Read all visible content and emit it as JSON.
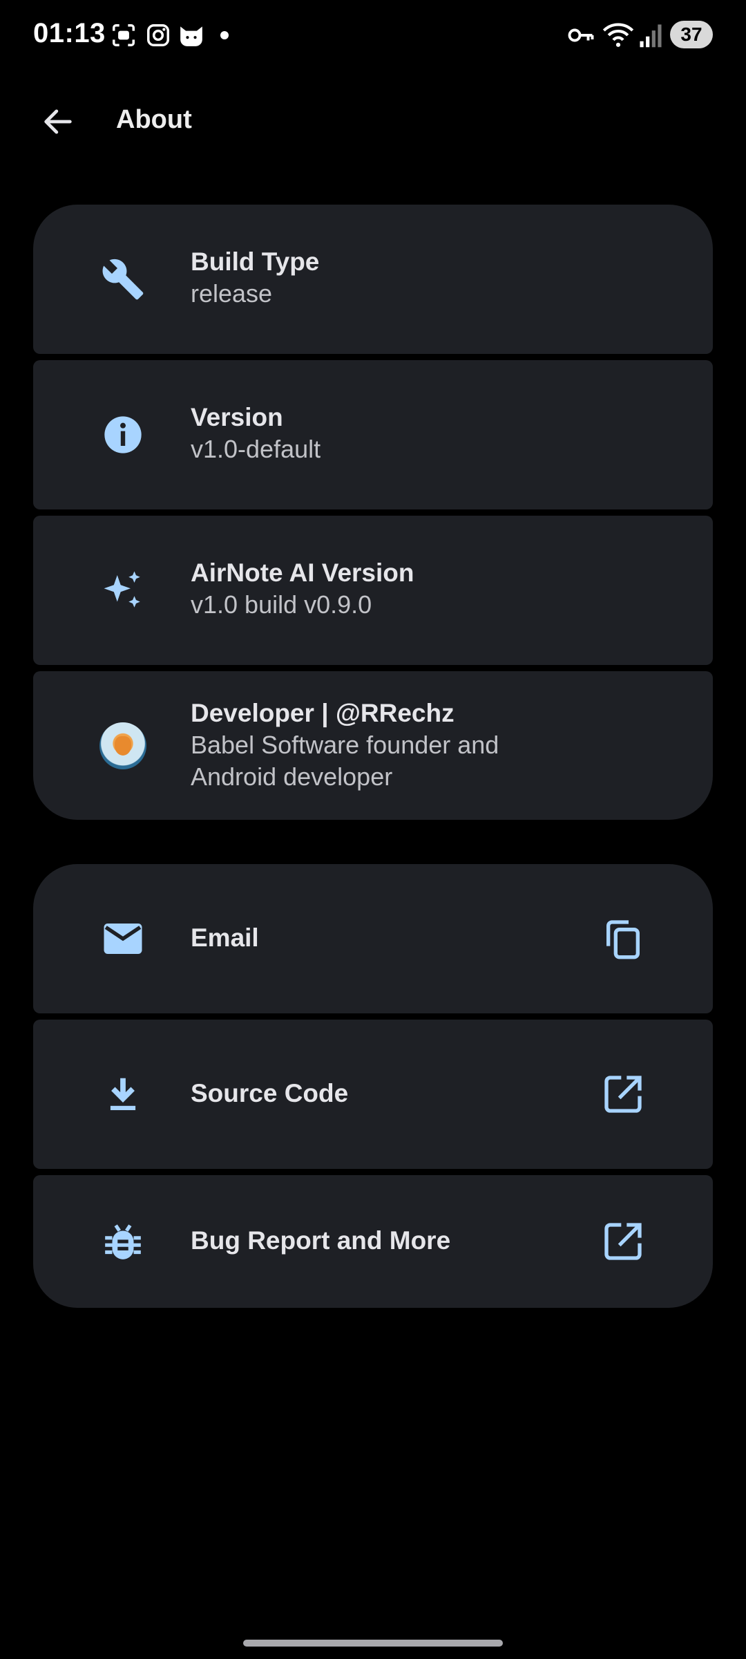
{
  "status_bar": {
    "time": "01:13",
    "battery": "37",
    "icons": [
      "screenshot-icon",
      "instagram-icon",
      "cat-app-icon",
      "notification-dot-icon",
      "vpn-key-icon",
      "wifi-icon",
      "signal-icon"
    ]
  },
  "app_bar": {
    "title": "About",
    "back_icon": "arrow-back-icon"
  },
  "info_items": [
    {
      "label": "Build Type",
      "value": "release",
      "icon": "wrench-icon"
    },
    {
      "label": "Version",
      "value": "v1.0-default",
      "icon": "info-icon"
    },
    {
      "label": "AirNote AI Version",
      "value": "v1.0 build v0.9.0",
      "icon": "sparkle-icon"
    },
    {
      "label": "Developer | @RRechz",
      "value_line1": "Babel Software founder and",
      "value_line2": "Android developer",
      "icon": "developer-avatar"
    }
  ],
  "link_items": [
    {
      "label": "Email",
      "icon": "email-icon",
      "action_icon": "copy-icon"
    },
    {
      "label": "Source Code",
      "icon": "download-icon",
      "action_icon": "open-external-icon"
    },
    {
      "label": "Bug Report and More",
      "icon": "bug-icon",
      "action_icon": "open-external-icon"
    }
  ],
  "colors": {
    "background": "#000000",
    "card": "#1e2025",
    "accent": "#a8d4ff",
    "text_primary": "#e6e6ea",
    "text_secondary": "#c2c3c8"
  }
}
